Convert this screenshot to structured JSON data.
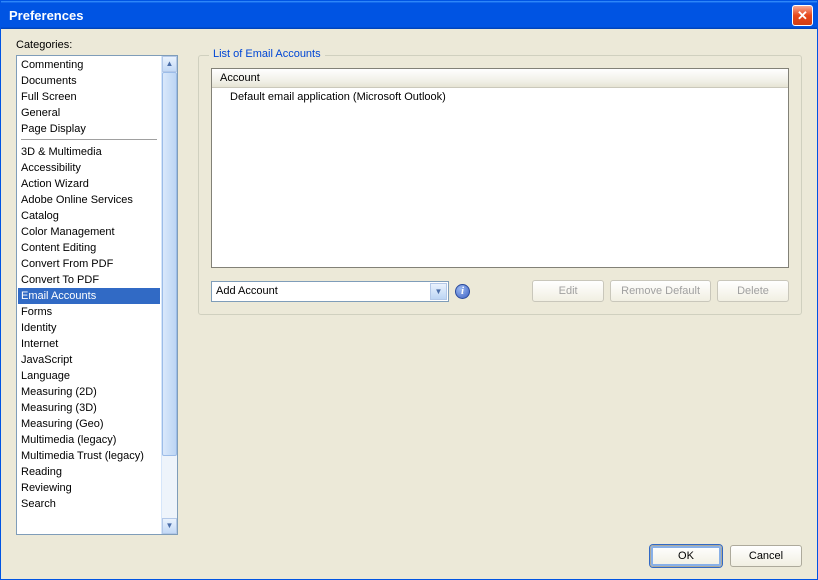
{
  "window": {
    "title": "Preferences"
  },
  "categories": {
    "label": "Categories:",
    "top": [
      "Commenting",
      "Documents",
      "Full Screen",
      "General",
      "Page Display"
    ],
    "rest": [
      "3D & Multimedia",
      "Accessibility",
      "Action Wizard",
      "Adobe Online Services",
      "Catalog",
      "Color Management",
      "Content Editing",
      "Convert From PDF",
      "Convert To PDF",
      "Email Accounts",
      "Forms",
      "Identity",
      "Internet",
      "JavaScript",
      "Language",
      "Measuring (2D)",
      "Measuring (3D)",
      "Measuring (Geo)",
      "Multimedia (legacy)",
      "Multimedia Trust (legacy)",
      "Reading",
      "Reviewing",
      "Search"
    ],
    "selected": "Email Accounts"
  },
  "emailPanel": {
    "groupTitle": "List of Email Accounts",
    "columnHeader": "Account",
    "rows": [
      "Default email application (Microsoft Outlook)"
    ],
    "dropdown": {
      "selected": "Add Account"
    },
    "buttons": {
      "edit": "Edit",
      "removeDefault": "Remove Default",
      "delete": "Delete"
    }
  },
  "footer": {
    "ok": "OK",
    "cancel": "Cancel"
  }
}
